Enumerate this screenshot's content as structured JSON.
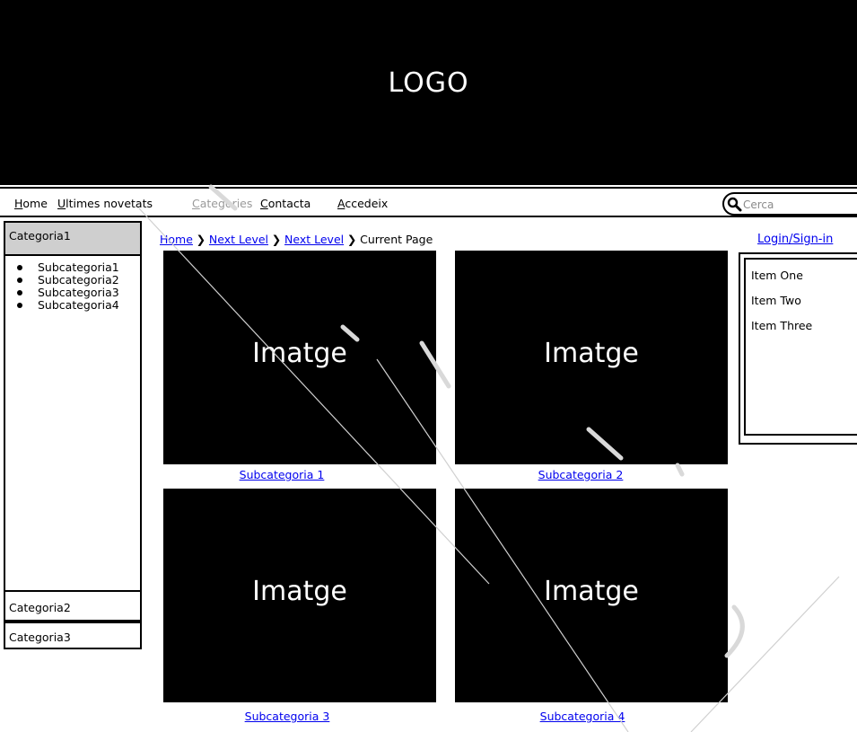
{
  "header": {
    "logo": "LOGO"
  },
  "nav": {
    "items": [
      {
        "mnemonic": "H",
        "rest": "ome",
        "disabled": false
      },
      {
        "mnemonic": "U",
        "rest": "ltimes novetats",
        "disabled": false
      },
      {
        "mnemonic": "C",
        "rest": "ategories",
        "disabled": true
      },
      {
        "mnemonic": "C",
        "rest": "ontacta",
        "disabled": false
      },
      {
        "mnemonic": "A",
        "rest": "ccedeix",
        "disabled": false
      }
    ],
    "search_placeholder": "Cerca"
  },
  "sidebar": {
    "categories": [
      {
        "label": "Categoria1",
        "subcategories": [
          "Subcategoria1",
          "Subcategoria2",
          "Subcategoria3",
          "Subcategoria4"
        ]
      },
      {
        "label": "Categoria2"
      },
      {
        "label": "Categoria3"
      }
    ]
  },
  "breadcrumb": [
    "Home",
    "Next Level",
    "Next Level",
    "Current Page"
  ],
  "tiles": [
    {
      "image_text": "Imatge",
      "caption": "Subcategoria 1"
    },
    {
      "image_text": "Imatge",
      "caption": "Subcategoria 2"
    },
    {
      "image_text": "Imatge",
      "caption": "Subcategoria 3"
    },
    {
      "image_text": "Imatge",
      "caption": "Subcategoria 4"
    }
  ],
  "right_panel": {
    "login_label": "Login/Sign-in",
    "items": [
      "Item One",
      "Item Two",
      "Item Three"
    ]
  },
  "colors": {
    "header_bg": "#000000",
    "link": "#0000ee",
    "selected_category_bg": "#cfcfcf",
    "disabled_text": "#9a9a9a"
  }
}
